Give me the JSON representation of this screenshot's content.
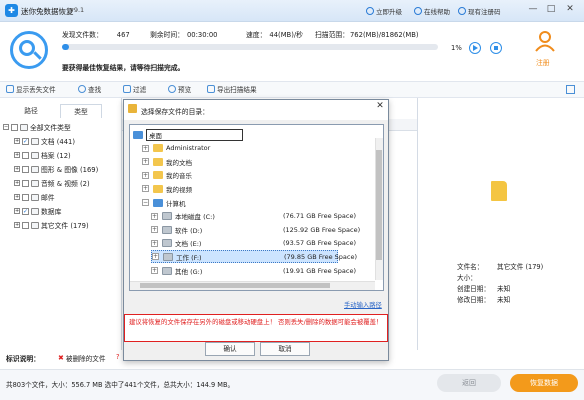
{
  "window": {
    "title": "迷你兔数据恢复",
    "version": "v9.1",
    "links": [
      "立即升级",
      "在线帮助",
      "现有注册码"
    ],
    "controls": [
      "—",
      "□",
      "✕"
    ]
  },
  "scan": {
    "found_label": "发现文件数：",
    "found_value": "467",
    "remaining_label": "剩余时间：",
    "remaining_value": "00:30:00",
    "speed_label": "速度：",
    "speed_value": "44(MB)/秒",
    "range_label": "扫描范围：",
    "range_value": "762(MB)/81862(MB)",
    "progress_percent": 1,
    "progress_text": "1%",
    "message": "要获得最佳恢复结果，请等待扫描完成。"
  },
  "register": {
    "label": "注册"
  },
  "toolbar": {
    "items": [
      "显示丢失文件",
      "查找",
      "过滤",
      "预览",
      "导出扫描结果"
    ]
  },
  "left_panel": {
    "tabs": [
      "路径",
      "类型"
    ],
    "tree": [
      {
        "label": "全部文件类型",
        "level": 0
      },
      {
        "label": "文档 (441)",
        "level": 1,
        "checked": true
      },
      {
        "label": "档案 (12)",
        "level": 1
      },
      {
        "label": "图形 & 图像 (169)",
        "level": 1
      },
      {
        "label": "音频 & 视频 (2)",
        "level": 1
      },
      {
        "label": "邮件",
        "level": 1
      },
      {
        "label": "数据库",
        "level": 1,
        "checked": true
      },
      {
        "label": "其它文件 (179)",
        "level": 1
      }
    ]
  },
  "dialog": {
    "title": "选择保存文件的目录：",
    "tree": [
      {
        "label": "桌面",
        "type": "desktop",
        "indent": 0,
        "size": ""
      },
      {
        "label": "Administrator",
        "type": "user",
        "indent": 1,
        "size": ""
      },
      {
        "label": "我的文档",
        "type": "folder",
        "indent": 1,
        "size": ""
      },
      {
        "label": "我的音乐",
        "type": "folder",
        "indent": 1,
        "size": ""
      },
      {
        "label": "我的视频",
        "type": "folder",
        "indent": 1,
        "size": ""
      },
      {
        "label": "计算机",
        "type": "pc",
        "indent": 1,
        "size": ""
      },
      {
        "label": "本地磁盘 (C:)",
        "type": "drive",
        "indent": 2,
        "size": "(76.71 GB Free Space)"
      },
      {
        "label": "软件 (D:)",
        "type": "drive",
        "indent": 2,
        "size": "(125.92 GB Free Space)"
      },
      {
        "label": "文档 (E:)",
        "type": "drive",
        "indent": 2,
        "size": "(93.57 GB Free Space)"
      },
      {
        "label": "工作 (F:)",
        "type": "drive",
        "indent": 2,
        "size": "(79.85 GB Free Space)",
        "selected": true
      },
      {
        "label": "其他 (G:)",
        "type": "drive",
        "indent": 2,
        "size": "(19.91 GB Free Space)"
      }
    ],
    "manual_input": "手动输入路径",
    "warning": "建议将恢复的文件保存在另外的磁盘或移动硬盘上！ 否则丢失/删除的数据可能会被覆盖！",
    "ok": "确认",
    "cancel": "取消"
  },
  "file_info": {
    "rows": [
      {
        "label": "文件名：",
        "value": "其它文件 (179)"
      },
      {
        "label": "大小：",
        "value": ""
      },
      {
        "label": "创建日期：",
        "value": "未知"
      },
      {
        "label": "修改日期：",
        "value": "未知"
      }
    ]
  },
  "legend": {
    "label": "标识说明：",
    "deleted": "被删除的文件",
    "deleted_mark": "✖",
    "extra": "?"
  },
  "status": {
    "text": "共803个文件，大小：556.7 MB    选中了441个文件，总共大小：144.9 MB。"
  },
  "buttons": {
    "back": "返回",
    "recover": "恢复数据"
  },
  "colors": {
    "accent": "#2f8fe8",
    "recover": "#f39a1b",
    "warning": "#e02020"
  }
}
